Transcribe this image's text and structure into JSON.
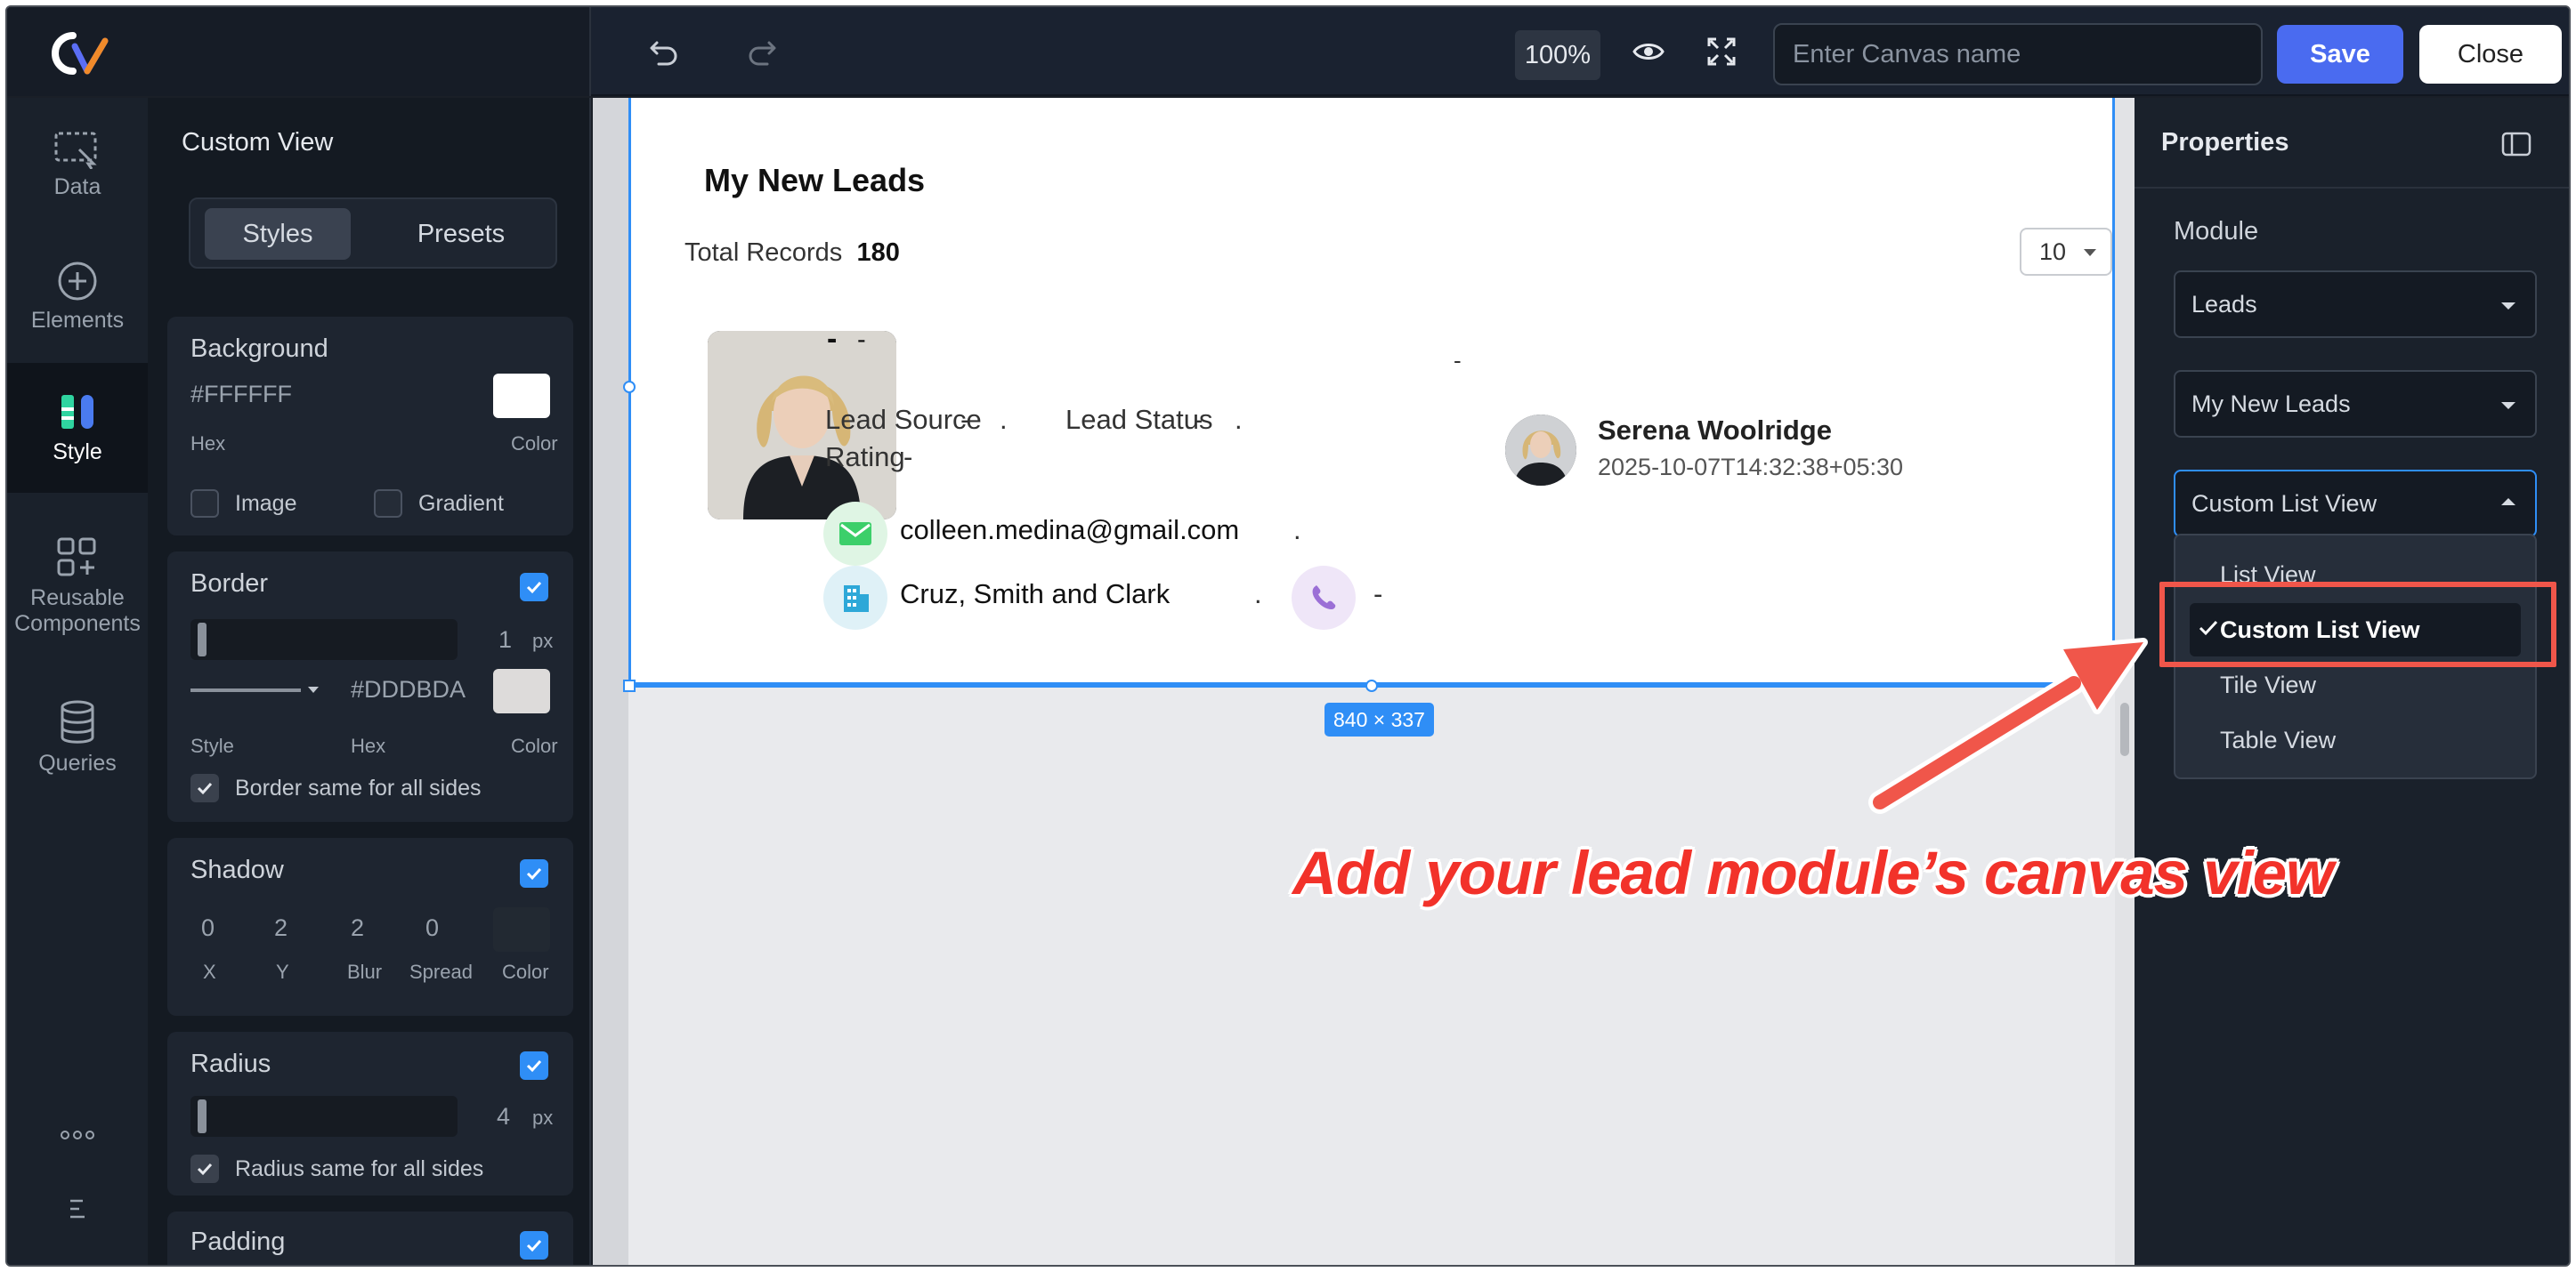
{
  "toolbar": {
    "zoom": "100%",
    "canvas_name_placeholder": "Enter Canvas name",
    "save_label": "Save",
    "close_label": "Close"
  },
  "rail": {
    "items": [
      {
        "label": "Data",
        "icon": "data-select-icon"
      },
      {
        "label": "Elements",
        "icon": "plus-circle-icon"
      },
      {
        "label": "Style",
        "icon": "style-icon"
      },
      {
        "label": "Reusable Components",
        "icon": "components-icon"
      },
      {
        "label": "Queries",
        "icon": "database-icon"
      }
    ],
    "more_icon": "more-dots-icon",
    "menu_icon": "menu-lines-icon"
  },
  "style_panel": {
    "title": "Custom View",
    "tabs": [
      "Styles",
      "Presets"
    ],
    "background": {
      "title": "Background",
      "hex": "#FFFFFF",
      "hex_label": "Hex",
      "color_label": "Color",
      "image_label": "Image",
      "gradient_label": "Gradient"
    },
    "border": {
      "title": "Border",
      "width": "1",
      "unit": "px",
      "style_label": "Style",
      "hex": "#DDDBDA",
      "hex_label": "Hex",
      "color_label": "Color",
      "same_all_label": "Border same for all sides"
    },
    "shadow": {
      "title": "Shadow",
      "values": [
        "0",
        "2",
        "2",
        "0"
      ],
      "labels": [
        "X",
        "Y",
        "Blur",
        "Spread",
        "Color"
      ]
    },
    "radius": {
      "title": "Radius",
      "value": "4",
      "unit": "px",
      "same_all_label": "Radius same for all sides"
    },
    "padding": {
      "title": "Padding"
    }
  },
  "widget": {
    "title": "My New Leads",
    "total_label": "Total Records",
    "total_value": "180",
    "page_size": "10",
    "record": {
      "name_dash": "-",
      "sub_dash": "-",
      "lead_source_label": "Lead Source",
      "lead_source_value": "-",
      "lead_status_label": "Lead Status",
      "lead_status_value": "-",
      "rating_label": "Rating",
      "rating_value": "-",
      "separator": ".",
      "email": "colleen.medina@gmail.com",
      "company": "Cruz, Smith and Clark",
      "phone": "-",
      "right_dash": "-",
      "owner_name": "Serena Woolridge",
      "owner_time": "2025-10-07T14:32:38+05:30"
    },
    "size_badge": "840 × 337"
  },
  "properties": {
    "title": "Properties",
    "module_label": "Module",
    "module_value": "Leads",
    "view_value": "My New Leads",
    "layout_value": "Custom List View",
    "options": [
      "List View",
      "Custom List View",
      "Tile View",
      "Table View"
    ],
    "selected_option": "Custom List View"
  },
  "annotation": {
    "text": "Add your lead module’s canvas view",
    "color": "#f2322a"
  },
  "colors": {
    "accent": "#2f8ef6",
    "save": "#4a6bf0",
    "highlight": "#f0564a"
  }
}
